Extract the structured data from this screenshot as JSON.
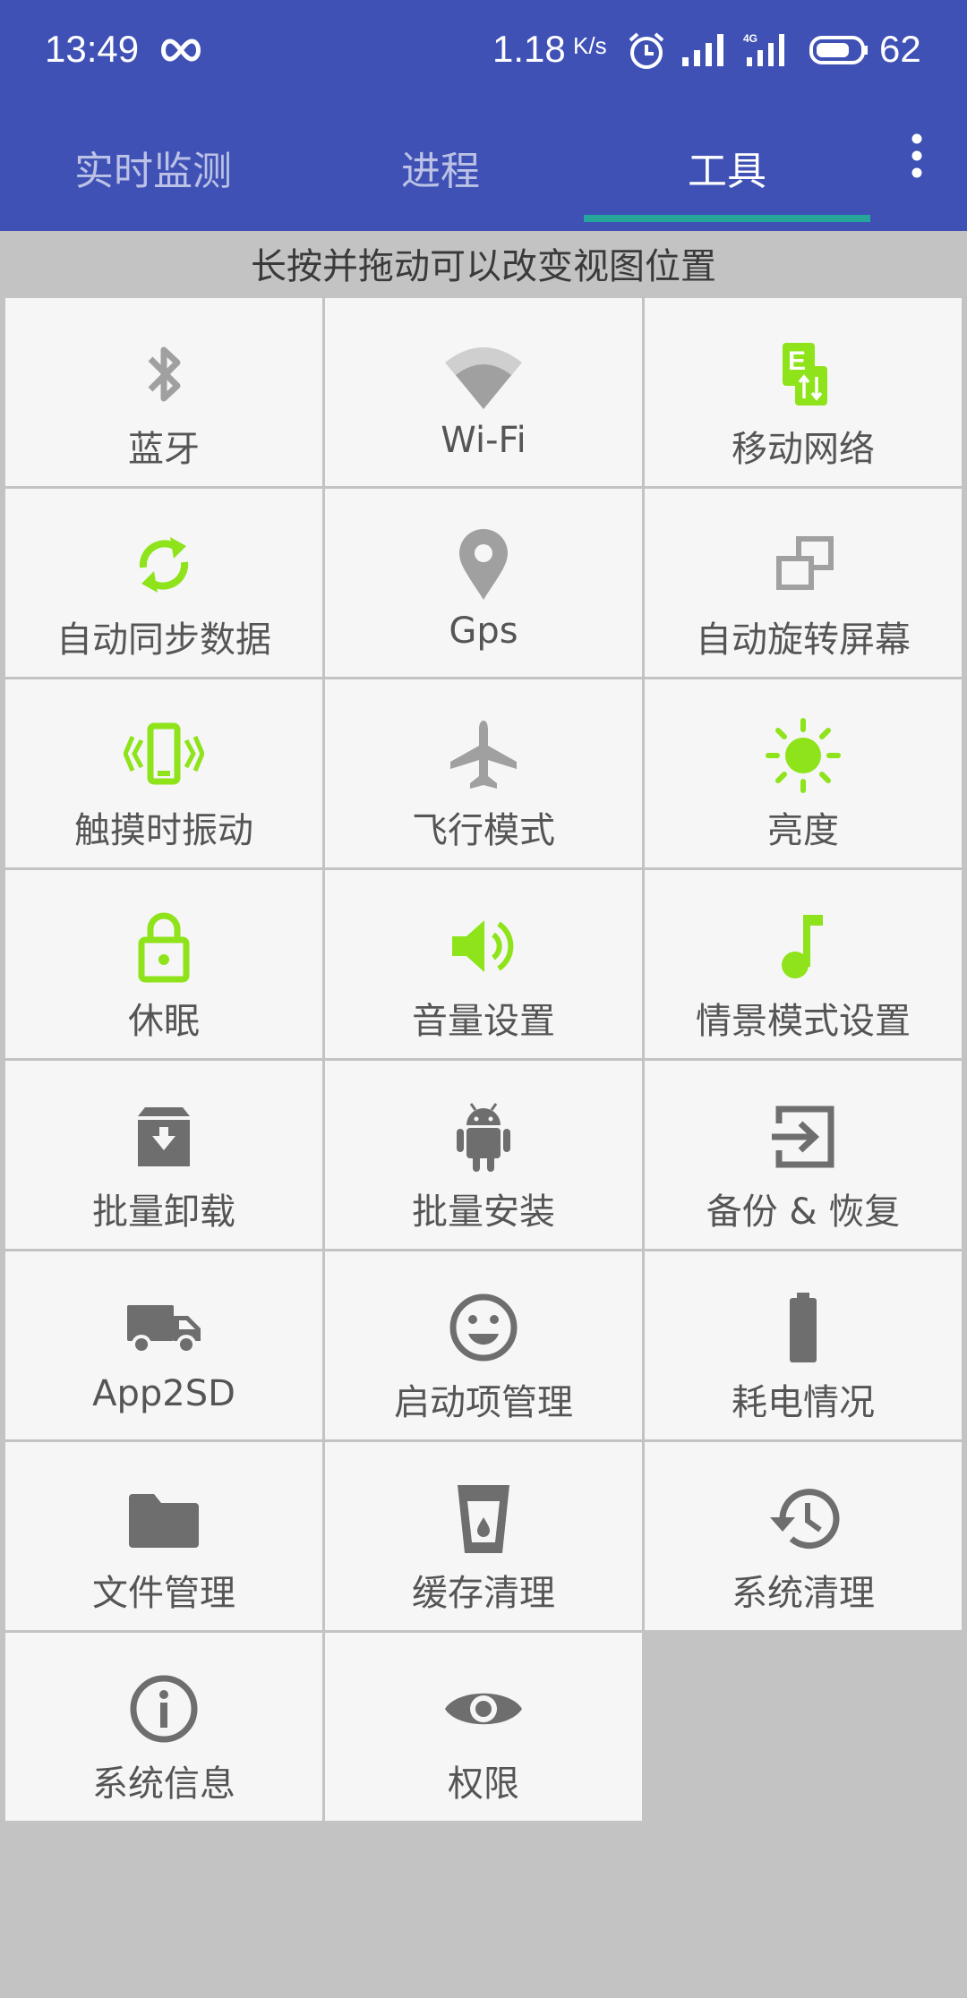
{
  "status_bar": {
    "time": "13:49",
    "net_speed": "1.18",
    "net_unit": "K/s",
    "battery": "62"
  },
  "tabs": [
    {
      "label": "实时监测",
      "active": false
    },
    {
      "label": "进程",
      "active": false
    },
    {
      "label": "工具",
      "active": true
    }
  ],
  "hint": "长按并拖动可以改变视图位置",
  "colors": {
    "header": "#3f51b5",
    "indicator": "#26a69a",
    "accent_green": "#8ee31a",
    "icon_gray": "#6e6e6e",
    "icon_light": "#a0a0a0"
  },
  "tools": [
    {
      "label": "蓝牙",
      "icon": "bluetooth-icon"
    },
    {
      "label": "Wi-Fi",
      "icon": "wifi-icon"
    },
    {
      "label": "移动网络",
      "icon": "mobile-data-icon"
    },
    {
      "label": "自动同步数据",
      "icon": "sync-icon"
    },
    {
      "label": "Gps",
      "icon": "location-pin-icon"
    },
    {
      "label": "自动旋转屏幕",
      "icon": "screen-rotation-icon"
    },
    {
      "label": "触摸时振动",
      "icon": "vibration-icon"
    },
    {
      "label": "飞行模式",
      "icon": "airplane-icon"
    },
    {
      "label": "亮度",
      "icon": "brightness-icon"
    },
    {
      "label": "休眠",
      "icon": "lock-icon"
    },
    {
      "label": "音量设置",
      "icon": "volume-icon"
    },
    {
      "label": "情景模式设置",
      "icon": "music-note-icon"
    },
    {
      "label": "批量卸载",
      "icon": "archive-icon"
    },
    {
      "label": "批量安装",
      "icon": "android-icon"
    },
    {
      "label": "备份 & 恢复",
      "icon": "backup-restore-icon"
    },
    {
      "label": "App2SD",
      "icon": "truck-icon"
    },
    {
      "label": "启动项管理",
      "icon": "smiley-icon"
    },
    {
      "label": "耗电情况",
      "icon": "battery-usage-icon"
    },
    {
      "label": "文件管理",
      "icon": "folder-icon"
    },
    {
      "label": "缓存清理",
      "icon": "cup-icon"
    },
    {
      "label": "系统清理",
      "icon": "history-icon"
    },
    {
      "label": "系统信息",
      "icon": "info-icon"
    },
    {
      "label": "权限",
      "icon": "eye-icon"
    }
  ]
}
